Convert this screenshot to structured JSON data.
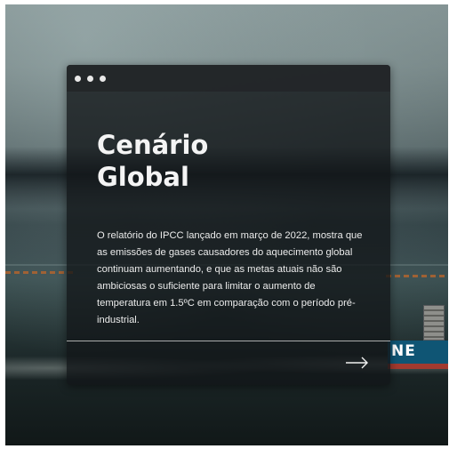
{
  "window": {
    "title_lines": [
      "Cenário",
      "Global"
    ],
    "body_text": "O relatório do IPCC lançado em março de 2022, mostra que as emissões de gases causadores do aquecimento global continuam aumentando, e que as metas atuais não são ambiciosas o suficiente para limitar o aumento de temperatura em 1.5ºC em comparação com o período pré-industrial.",
    "next_icon": "arrow-right-icon",
    "window_controls_icon": "dots-icon"
  },
  "background": {
    "ship_hull_text": "NE"
  },
  "colors": {
    "card_background": "#121618",
    "text": "#f4f4f4",
    "ship_hull": "#0f5574"
  }
}
